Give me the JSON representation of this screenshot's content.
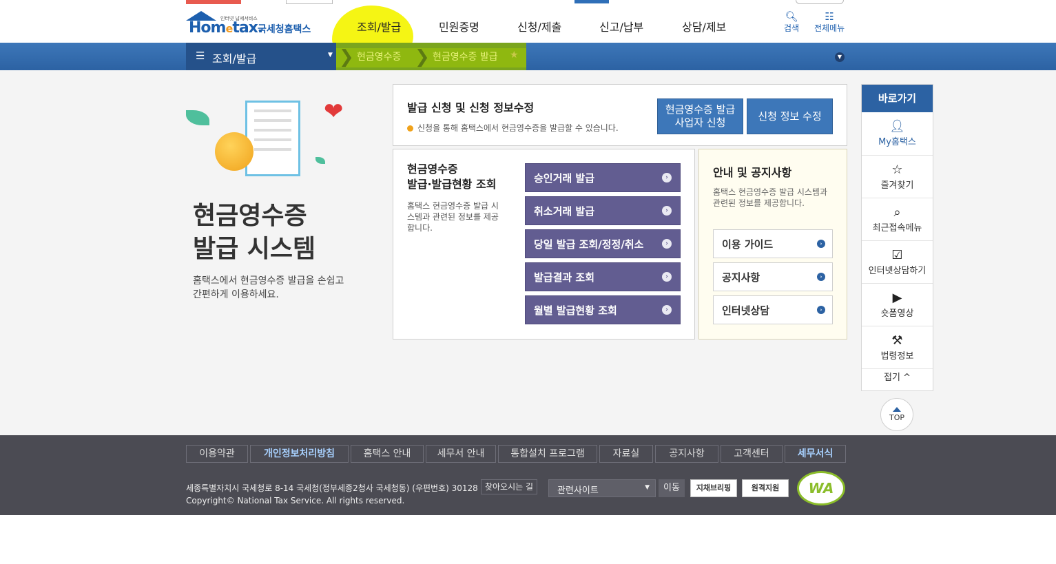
{
  "header": {
    "logo_sub": "인터넷 납세서비스",
    "logo_brand_a": "Hom",
    "logo_brand_e": "e",
    "logo_brand_b": "tax.",
    "logo_kor": "국세청홈택스",
    "gnb": [
      "조회/발급",
      "민원증명",
      "신청/제출",
      "신고/납부",
      "상담/제보"
    ],
    "search_label": "검색",
    "allmenu_label": "전체메뉴"
  },
  "subnav": {
    "menu_label": "조회/발급",
    "crumbs": [
      "현금영수증",
      "현금영수증 발급"
    ]
  },
  "hero": {
    "title_line1": "현금영수증",
    "title_line2": "발급 시스템",
    "desc_line1": "홈택스에서 현금영수증 발급을 손쉽고",
    "desc_line2": "간편하게 이용하세요."
  },
  "apply": {
    "title": "발급 신청 및 신청 정보수정",
    "note": "신청을 통해 홈택스에서 현금영수증을 발급할 수 있습니다.",
    "btn1_line1": "현금영수증 발급",
    "btn1_line2": "사업자 신청",
    "btn2": "신청 정보 수정"
  },
  "issue": {
    "title_line1": "현금영수증",
    "title_line2": "발급·발급현황 조회",
    "desc": "홈택스 현금영수증 발급 시스템과 관련된 정보를 제공합니다.",
    "buttons": [
      "승인거래 발급",
      "취소거래 발급",
      "당일 발급 조회/정정/취소",
      "발급결과 조회",
      "월별 발급현황 조회"
    ]
  },
  "notice": {
    "title": "안내 및 공지사항",
    "desc": "홈택스 현금영수증 발급 시스템과 관련된 정보를 제공합니다.",
    "buttons": [
      "이용 가이드",
      "공지사항",
      "인터넷상담"
    ]
  },
  "quick": {
    "head": "바로가기",
    "items": [
      "My홈택스",
      "즐겨찾기",
      "최근접속메뉴",
      "인터넷상담하기",
      "숏폼영상",
      "법령정보"
    ],
    "fold": "접기 ^",
    "top": "TOP"
  },
  "footer": {
    "links": [
      "이용약관",
      "개인정보처리방침",
      "홈택스 안내",
      "세무서 안내",
      "통합설치 프로그램",
      "자료실",
      "공지사항",
      "고객센터",
      "세무서식"
    ],
    "address": "세종특별자치시 국세청로 8-14 국세청(정부세종2청사 국세청동) (우편번호) 30128",
    "find": "찾아오시는 길",
    "copyright": "Copyright© National Tax Service. All rights reserved.",
    "related": "관련사이트",
    "move": "이동",
    "badge1": "지채브리핑",
    "badge2": "원격지원",
    "wa": "WA"
  }
}
